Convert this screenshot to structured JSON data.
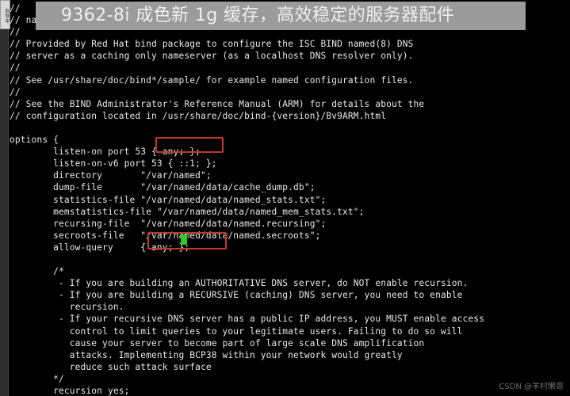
{
  "window": {
    "background_color": "#000000",
    "text_color": "#e8e8e8",
    "side_tab_label": "购物车"
  },
  "ad_banner": {
    "text": "9362-8i 成色新 1g 缓存，高效稳定的服务器配件",
    "background_color": "#9b9b9b",
    "text_color": "#efefef"
  },
  "watermark": {
    "text": "CSDN @羊村懒哥",
    "color": "#6d6d6d"
  },
  "highlights": {
    "box_color": "#c0392b",
    "cursor_color": "#27d027",
    "listen_on_value": "{ any; };",
    "allow_query_value": "{ any; };"
  },
  "terminal": {
    "lines": [
      "//",
      "// named.conf",
      "//",
      "// Provided by Red Hat bind package to configure the ISC BIND named(8) DNS",
      "// server as a caching only nameserver (as a localhost DNS resolver only).",
      "//",
      "// See /usr/share/doc/bind*/sample/ for example named configuration files.",
      "//",
      "// See the BIND Administrator's Reference Manual (ARM) for details about the",
      "// configuration located in /usr/share/doc/bind-{version}/Bv9ARM.html",
      "",
      "options {",
      "        listen-on port 53 { any; };",
      "        listen-on-v6 port 53 { ::1; };",
      "        directory       \"/var/named\";",
      "        dump-file       \"/var/named/data/cache_dump.db\";",
      "        statistics-file \"/var/named/data/named_stats.txt\";",
      "        memstatistics-file \"/var/named/data/named_mem_stats.txt\";",
      "        recursing-file  \"/var/named/data/named.recursing\";",
      "        secroots-file   \"/var/named/data/named.secroots\";",
      "        allow-query     { any; };",
      "",
      "        /*",
      "         - If you are building an AUTHORITATIVE DNS server, do NOT enable recursion.",
      "         - If you are building a RECURSIVE (caching) DNS server, you need to enable",
      "           recursion.",
      "         - If your recursive DNS server has a public IP address, you MUST enable access",
      "           control to limit queries to your legitimate users. Failing to do so will",
      "           cause your server to become part of large scale DNS amplification",
      "           attacks. Implementing BCP38 within your network would greatly",
      "           reduce such attack surface",
      "        */",
      "        recursion yes;"
    ]
  }
}
